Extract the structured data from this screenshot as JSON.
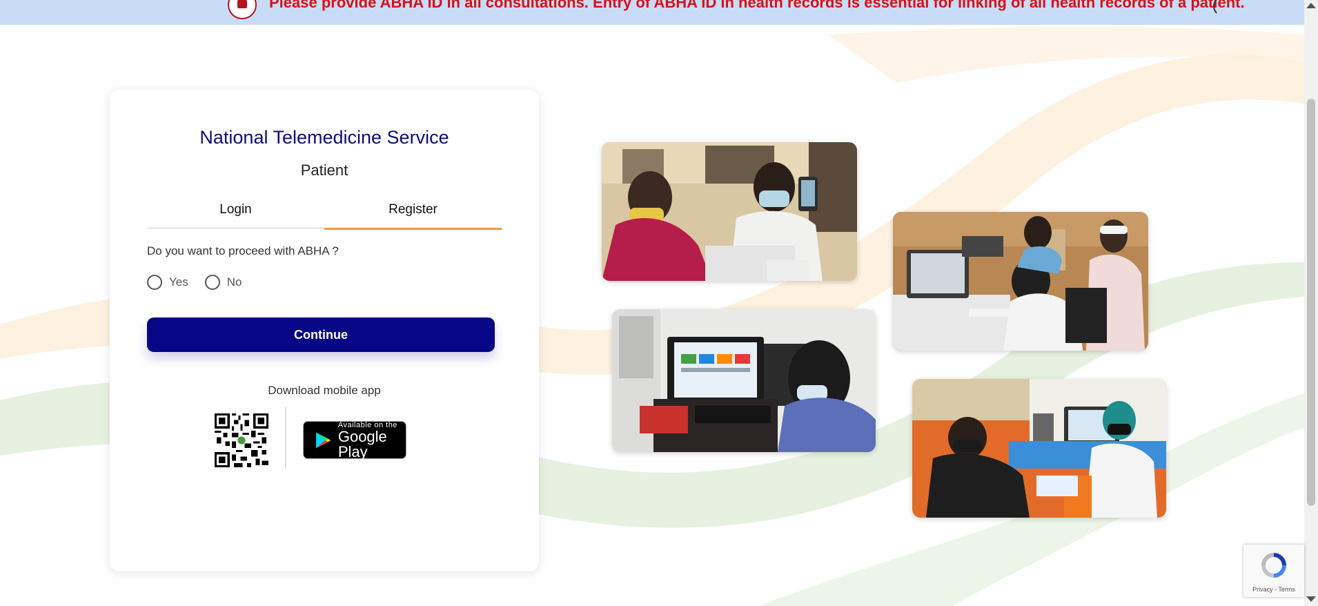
{
  "banner": {
    "text": "Please provide ABHA ID in all consultations. Entry of ABHA ID in health records is essential for linking of all health records of a patient."
  },
  "card": {
    "title": "National Telemedicine Service",
    "subtitle": "Patient",
    "tabs": [
      {
        "label": "Login",
        "active": false
      },
      {
        "label": "Register",
        "active": true
      }
    ],
    "question": "Do you want to proceed with ABHA ?",
    "options": [
      {
        "label": "Yes",
        "selected": false
      },
      {
        "label": "No",
        "selected": false
      }
    ],
    "continue_label": "Continue",
    "download_text": "Download mobile app",
    "google_play": {
      "small": "Available on the",
      "big": "Google Play"
    }
  },
  "colors": {
    "primary": "#060686",
    "title": "#0d0d7a",
    "tab_active": "#f39a3a",
    "banner_bg": "#c9dcf7",
    "banner_text": "#d91016"
  },
  "recaptcha": {
    "links": "Privacy - Terms"
  },
  "icons": [
    "emblem-icon",
    "qr-code-icon",
    "google-play-icon",
    "recaptcha-icon"
  ]
}
